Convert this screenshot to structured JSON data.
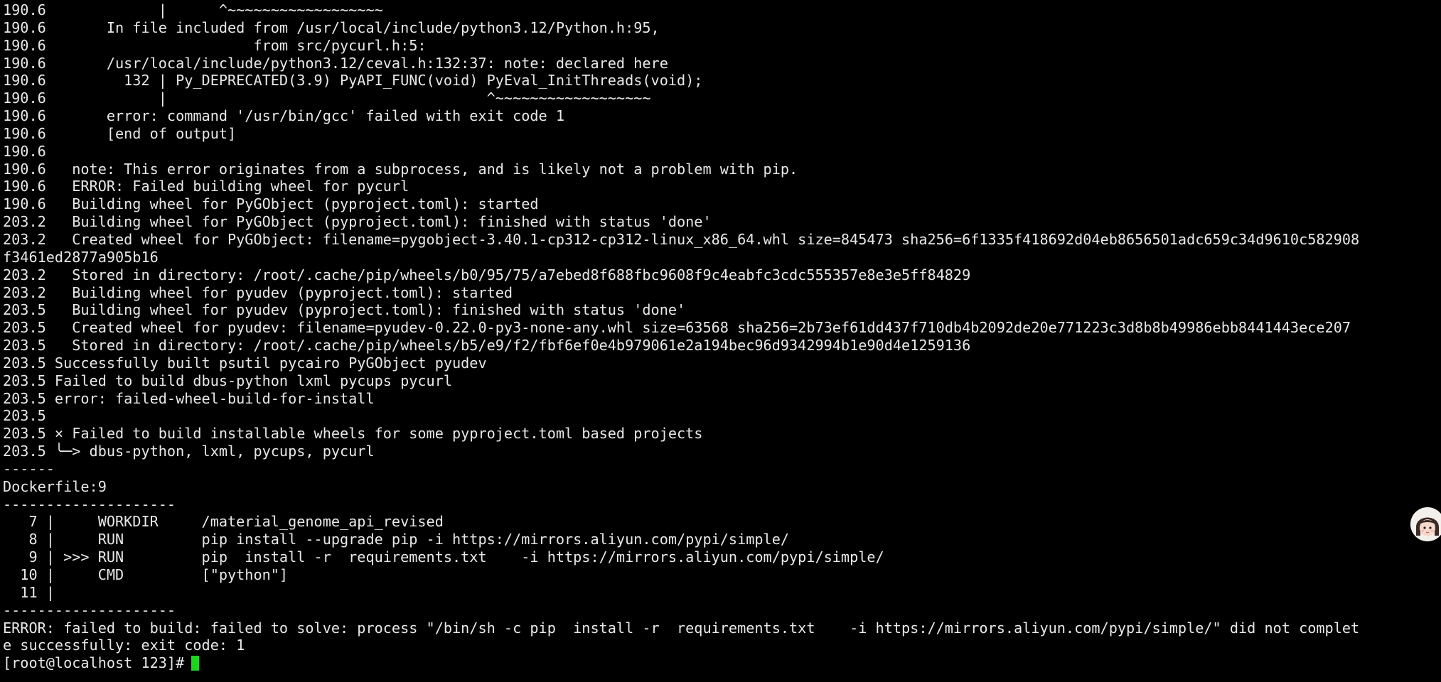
{
  "terminal": {
    "lines": [
      "190.6             |      ^~~~~~~~~~~~~~~~~~~",
      "190.6       In file included from /usr/local/include/python3.12/Python.h:95,",
      "190.6                        from src/pycurl.h:5:",
      "190.6       /usr/local/include/python3.12/ceval.h:132:37: note: declared here",
      "190.6         132 | Py_DEPRECATED(3.9) PyAPI_FUNC(void) PyEval_InitThreads(void);",
      "190.6             |                                     ^~~~~~~~~~~~~~~~~~~",
      "190.6       error: command '/usr/bin/gcc' failed with exit code 1",
      "190.6       [end of output]",
      "190.6",
      "190.6   note: This error originates from a subprocess, and is likely not a problem with pip.",
      "190.6   ERROR: Failed building wheel for pycurl",
      "190.6   Building wheel for PyGObject (pyproject.toml): started",
      "203.2   Building wheel for PyGObject (pyproject.toml): finished with status 'done'",
      "203.2   Created wheel for PyGObject: filename=pygobject-3.40.1-cp312-cp312-linux_x86_64.whl size=845473 sha256=6f1335f418692d04eb8656501adc659c34d9610c582908",
      "f3461ed2877a905b16",
      "203.2   Stored in directory: /root/.cache/pip/wheels/b0/95/75/a7ebed8f688fbc9608f9c4eabfc3cdc555357e8e3e5ff84829",
      "203.2   Building wheel for pyudev (pyproject.toml): started",
      "203.5   Building wheel for pyudev (pyproject.toml): finished with status 'done'",
      "203.5   Created wheel for pyudev: filename=pyudev-0.22.0-py3-none-any.whl size=63568 sha256=2b73ef61dd437f710db4b2092de20e771223c3d8b8b49986ebb8441443ece207",
      "203.5   Stored in directory: /root/.cache/pip/wheels/b5/e9/f2/fbf6ef0e4b979061e2a194bec96d9342994b1e90d4e1259136",
      "203.5 Successfully built psutil pycairo PyGObject pyudev",
      "203.5 Failed to build dbus-python lxml pycups pycurl",
      "203.5 error: failed-wheel-build-for-install",
      "203.5",
      "203.5 × Failed to build installable wheels for some pyproject.toml based projects",
      "203.5 ╰─> dbus-python, lxml, pycups, pycurl",
      "------",
      "Dockerfile:9",
      "--------------------",
      "   7 |     WORKDIR     /material_genome_api_revised",
      "   8 |     RUN         pip install --upgrade pip -i https://mirrors.aliyun.com/pypi/simple/",
      "   9 | >>> RUN         pip  install -r  requirements.txt    -i https://mirrors.aliyun.com/pypi/simple/",
      "  10 |     CMD         [\"python\"]",
      "  11 |",
      "--------------------",
      "ERROR: failed to build: failed to solve: process \"/bin/sh -c pip  install -r  requirements.txt    -i https://mirrors.aliyun.com/pypi/simple/\" did not complet",
      "e successfully: exit code: 1"
    ],
    "prompt": "[root@localhost 123]#",
    "cursor_color": "#1fd41f",
    "text_color": "#e8e8e8",
    "background_color": "#000000"
  },
  "overlay": {
    "avatar_icon": "assistant-avatar-icon"
  }
}
